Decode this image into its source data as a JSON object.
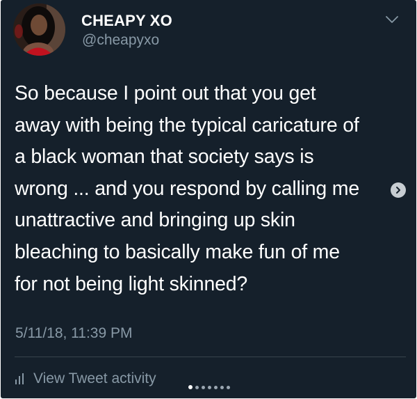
{
  "author": {
    "display_name": "CHEAPY XO",
    "handle": "@cheapyxo",
    "avatar_icon": "profile-photo"
  },
  "tweet": {
    "text": "So because I point out that you get\naway with being the typical caricature of\na black woman that society says is\nwrong ... and you respond by calling me\nunattractive and bringing up skin\nbleaching to basically make fun of me\nfor not being light skinned?",
    "timestamp": "5/11/18, 11:39 PM"
  },
  "actions": {
    "menu_icon": "chevron-down-icon",
    "activity_icon": "bar-chart-icon",
    "activity_label": "View Tweet activity"
  },
  "carousel": {
    "next_icon": "chevron-right-icon",
    "dot_count": 7,
    "active_index": 0
  },
  "colors": {
    "background": "#15202b",
    "primary_text": "#ffffff",
    "secondary_text": "#8899a6",
    "divider": "#38444d"
  }
}
